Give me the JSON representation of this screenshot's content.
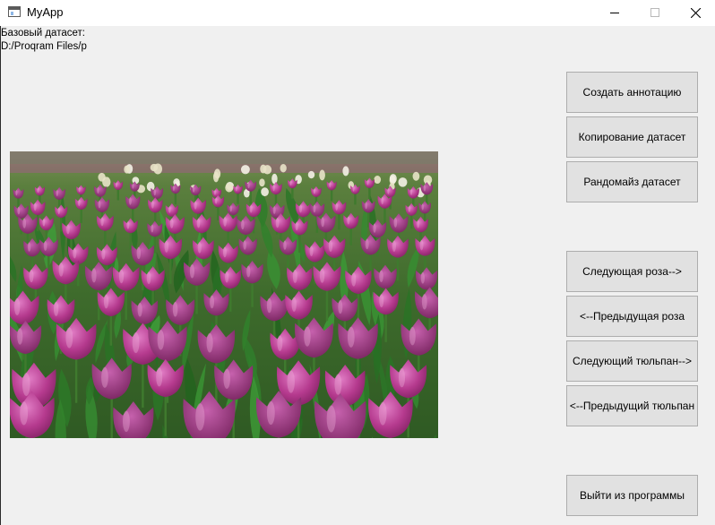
{
  "window": {
    "title": "MyApp",
    "controls": [
      "minimize-icon",
      "maximize-icon",
      "close-icon"
    ]
  },
  "dataset": {
    "label": "Базовый датасет:",
    "path": "D:/Proqram Files/p"
  },
  "image": {
    "subject": "tulip field"
  },
  "buttons": {
    "create_annotation": "Создать аннотацию",
    "copy_dataset": "Копирование датасет",
    "randomize_dataset": "Рандомайз датасет",
    "next_rose": "Следующая роза-->",
    "prev_rose": "<--Предыдущая роза",
    "next_tulip": "Следующий тюльпан-->",
    "prev_tulip": "<--Предыдущий тюльпан",
    "exit": "Выйти из программы"
  },
  "colors": {
    "window_bg": "#f0f0f0",
    "button_bg": "#e1e1e1",
    "button_border": "#adadad"
  }
}
